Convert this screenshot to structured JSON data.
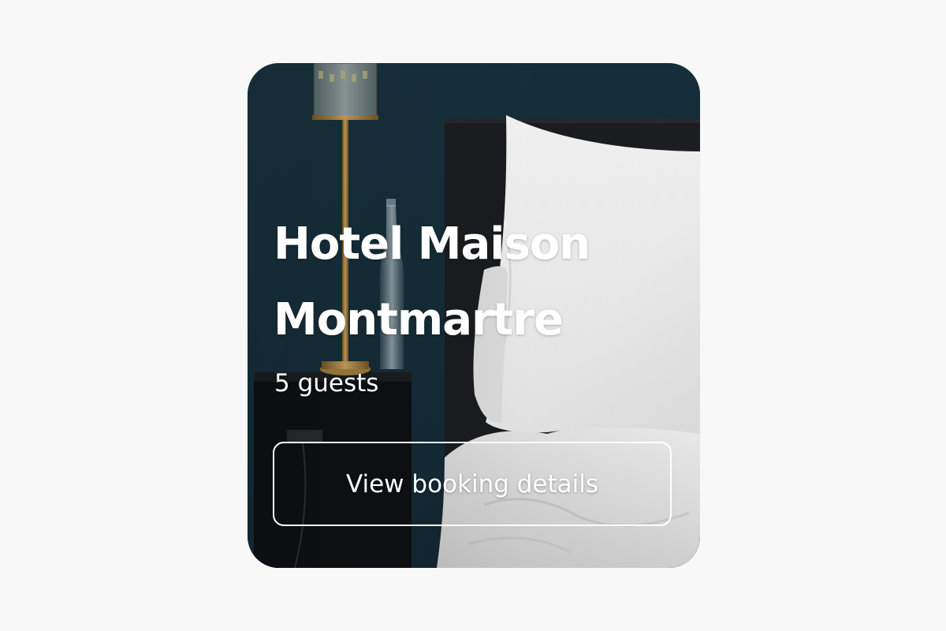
{
  "card": {
    "hotel_name": "Hotel Maison Montmartre",
    "guests": "5 guests",
    "button_label": "View booking details",
    "image_subject": "hotel-bedroom-photo"
  },
  "colors": {
    "page_background": "#f8f8f8",
    "wall": "#16303d",
    "headboard": "#1b1d20",
    "pillow": "#f2f2f2",
    "lamp_brass": "#b8904a",
    "text": "#ffffff"
  }
}
